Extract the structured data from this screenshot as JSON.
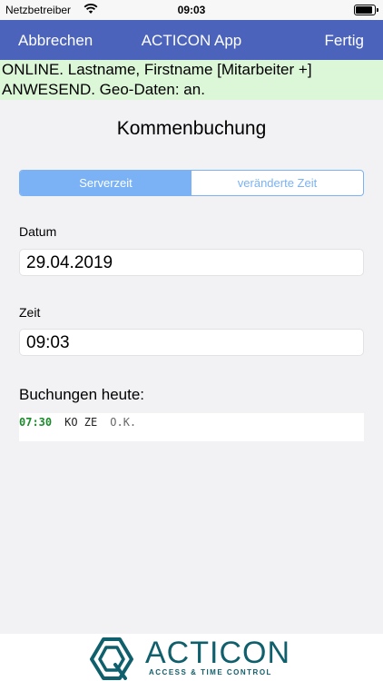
{
  "status_bar": {
    "carrier": "Netzbetreiber",
    "time": "09:03"
  },
  "nav": {
    "left": "Abbrechen",
    "title": "ACTICON App",
    "right": "Fertig"
  },
  "banner": {
    "line1": "ONLINE. Lastname, Firstname [Mitarbeiter +]",
    "line2": "ANWESEND. Geo-Daten: an."
  },
  "screen_title": "Kommenbuchung",
  "segments": [
    {
      "label": "Serverzeit",
      "active": true
    },
    {
      "label": "veränderte Zeit",
      "active": false
    }
  ],
  "date": {
    "label": "Datum",
    "value": "29.04.2019"
  },
  "time": {
    "label": "Zeit",
    "value": "09:03"
  },
  "bookings": {
    "header": "Buchungen heute:",
    "rows": [
      {
        "time": "07:30",
        "code": "KO ZE",
        "state": "O.K."
      }
    ]
  },
  "logo": {
    "word": "ACTICON",
    "subtitle": "ACCESS & TIME CONTROL",
    "color": "#0f5f6c"
  },
  "colors": {
    "nav": "#4b63ba",
    "banner": "#dcf6d8",
    "segment": "#7ab2f5",
    "booking_time": "#1a8c2a"
  }
}
